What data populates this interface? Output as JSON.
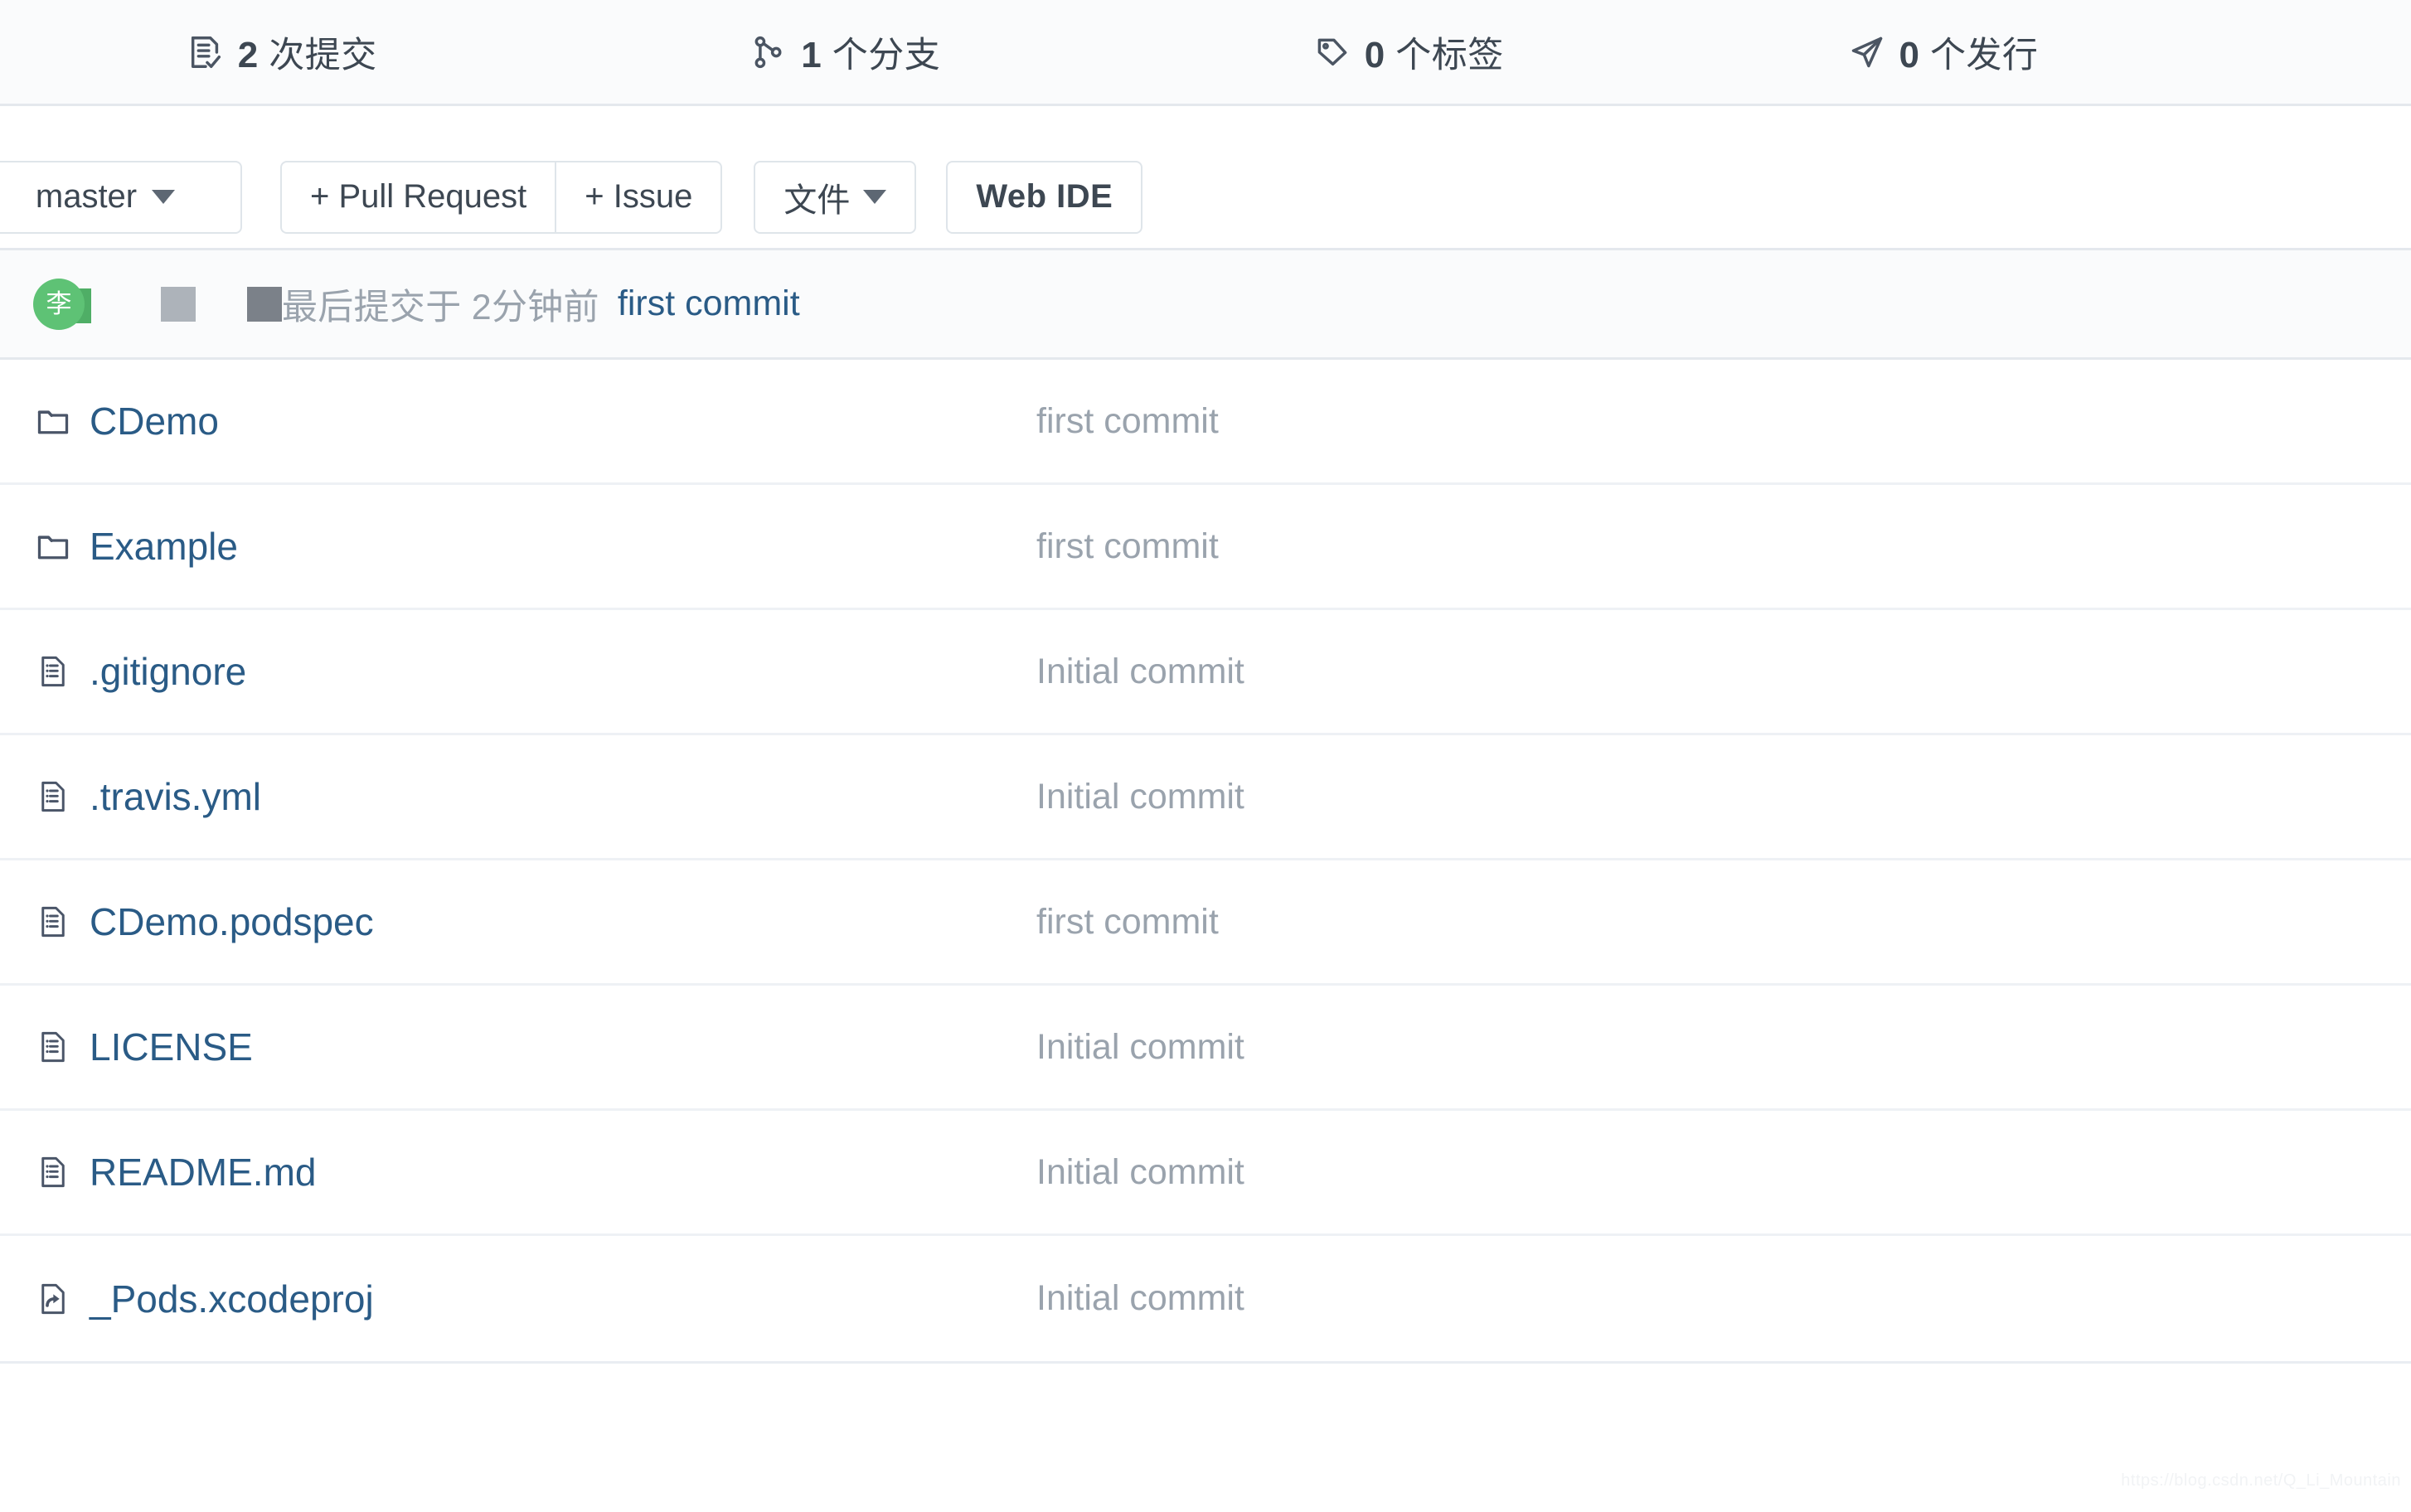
{
  "stats": [
    {
      "icon": "commit-history-icon",
      "count": "2",
      "label": "次提交"
    },
    {
      "icon": "branch-icon",
      "count": "1",
      "label": "个分支"
    },
    {
      "icon": "tag-icon",
      "count": "0",
      "label": "个标签"
    },
    {
      "icon": "release-icon",
      "count": "0",
      "label": "个发行"
    }
  ],
  "toolbar": {
    "branch": "master",
    "pull_request": "+ Pull Request",
    "issue": "+ Issue",
    "files": "文件",
    "web_ide": "Web IDE"
  },
  "commit_bar": {
    "avatar_initial": "李",
    "meta_text": "最后提交于 2分钟前",
    "commit_message": "first commit"
  },
  "files": [
    {
      "icon": "folder-icon",
      "name": "CDemo",
      "commit": "first commit"
    },
    {
      "icon": "folder-icon",
      "name": "Example",
      "commit": "first commit"
    },
    {
      "icon": "file-icon",
      "name": ".gitignore",
      "commit": "Initial commit"
    },
    {
      "icon": "file-icon",
      "name": ".travis.yml",
      "commit": "Initial commit"
    },
    {
      "icon": "file-icon",
      "name": "CDemo.podspec",
      "commit": "first commit"
    },
    {
      "icon": "file-icon",
      "name": "LICENSE",
      "commit": "Initial commit"
    },
    {
      "icon": "file-icon",
      "name": "README.md",
      "commit": "Initial commit"
    },
    {
      "icon": "symlink-icon",
      "name": "_Pods.xcodeproj",
      "commit": "Initial commit"
    }
  ],
  "watermark": "https://blog.csdn.net/Q_Li_Mountain",
  "colors": {
    "link": "#2a5b86",
    "muted": "#9aa3ad",
    "avatar_green": "#5ec275",
    "panel_bg": "#fafbfc",
    "border": "#e4e8ed"
  }
}
